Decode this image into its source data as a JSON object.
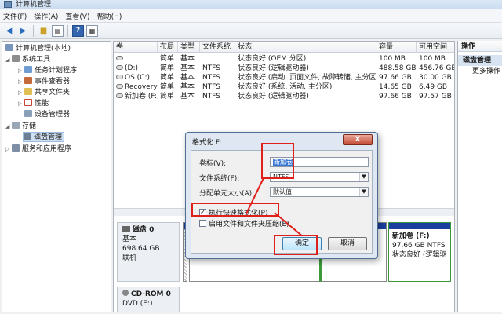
{
  "window": {
    "title": "计算机管理"
  },
  "menu": [
    "文件(F)",
    "操作(A)",
    "查看(V)",
    "帮助(H)"
  ],
  "toolbar": {
    "icons": [
      "back-arrow-icon",
      "forward-arrow-icon",
      "up-folder-icon",
      "show-hide-tree-icon",
      "help-icon",
      "properties-icon"
    ]
  },
  "tree": {
    "root": "计算机管理(本地)",
    "system_tools": "系统工具",
    "task_scheduler": "任务计划程序",
    "event_viewer": "事件查看器",
    "shared_folders": "共享文件夹",
    "performance": "性能",
    "device_manager": "设备管理器",
    "storage": "存储",
    "disk_management": "磁盘管理",
    "services_apps": "服务和应用程序"
  },
  "volumes": {
    "columns": [
      "卷",
      "布局",
      "类型",
      "文件系统",
      "状态",
      "容量",
      "可用空间"
    ],
    "rows": [
      [
        "",
        "简单",
        "基本",
        "",
        "状态良好 (OEM 分区)",
        "100 MB",
        "100 MB"
      ],
      [
        "(D:)",
        "简单",
        "基本",
        "NTFS",
        "状态良好 (逻辑驱动器)",
        "488.58 GB",
        "456.76 GB"
      ],
      [
        "OS (C:)",
        "简单",
        "基本",
        "NTFS",
        "状态良好 (启动, 页面文件, 故障转储, 主分区)",
        "97.66 GB",
        "30.00 GB"
      ],
      [
        "Recovery",
        "简单",
        "基本",
        "NTFS",
        "状态良好 (系统, 活动, 主分区)",
        "14.65 GB",
        "6.49 GB"
      ],
      [
        "新加卷 (F:)",
        "简单",
        "基本",
        "NTFS",
        "状态良好 (逻辑驱动器)",
        "97.66 GB",
        "97.57 GB"
      ]
    ]
  },
  "disks": {
    "disk0": {
      "name": "磁盘 0",
      "type": "基本",
      "size": "698.64 GB",
      "status": "联机"
    },
    "cdrom0": {
      "name": "CD-ROM 0",
      "type": "DVD (E:)"
    },
    "partition_f": {
      "name": "新加卷  (F:)",
      "size": "97.66 GB NTFS",
      "status": "状态良好 (逻辑驱"
    }
  },
  "actions": {
    "header": "操作",
    "selected": "磁盘管理",
    "more": "更多操作"
  },
  "dialog": {
    "title": "格式化 F:",
    "close": "X",
    "volume_label": "卷标(V):",
    "volume_value": "新加卷",
    "fs_label": "文件系统(F):",
    "fs_value": "NTFS",
    "alloc_label": "分配单元大小(A):",
    "alloc_value": "默认值",
    "quick_format": "执行快速格式化(P)",
    "compression": "启用文件和文件夹压缩(E)",
    "ok": "确定",
    "cancel": "取消"
  },
  "colors": {
    "annotation_red": "#e0201b",
    "partition_cap": "#1a3f9c",
    "partition_green": "#3a9a3a"
  }
}
